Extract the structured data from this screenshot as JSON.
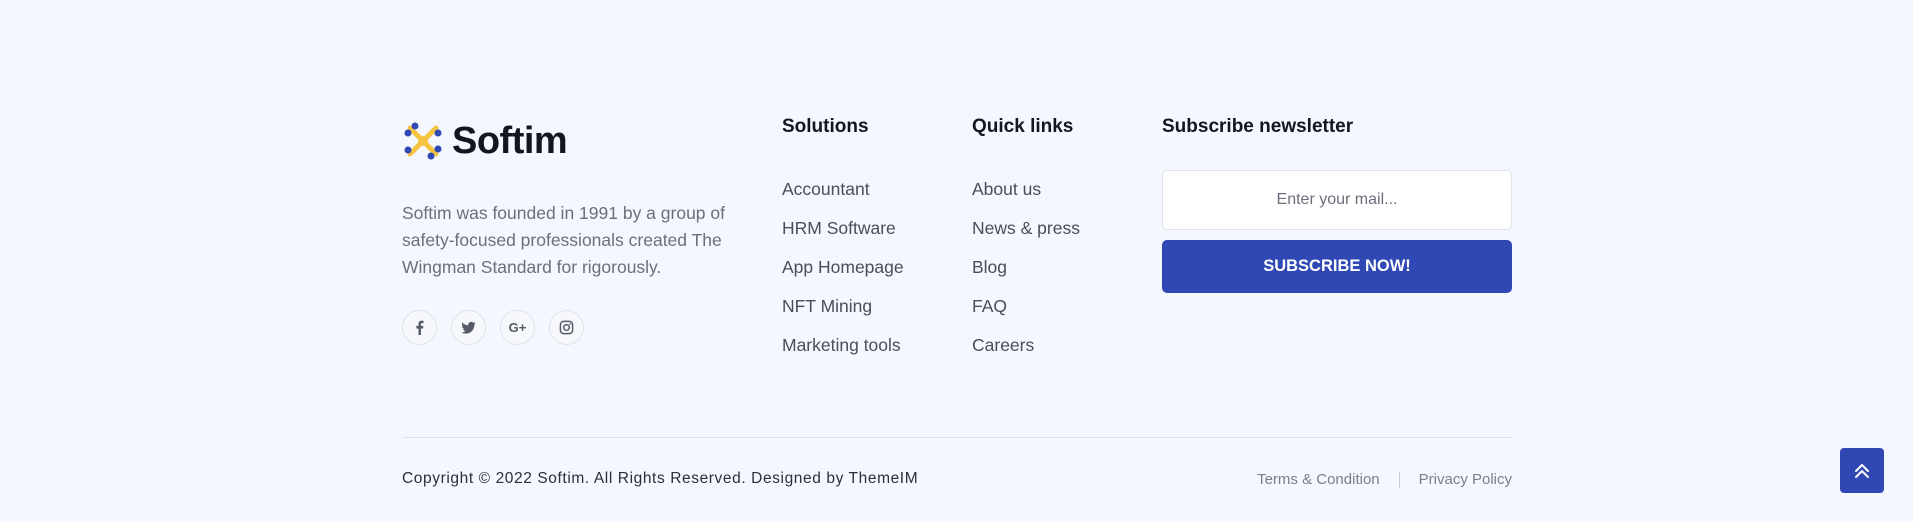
{
  "brand": {
    "name": "Softim",
    "about": "Softim was founded in 1991 by a group of safety-focused professionals created The Wingman Standard for rigorously.",
    "colors": {
      "primary": "#3048b4",
      "accent": "#f5c443"
    }
  },
  "socials": [
    {
      "icon": "facebook-icon"
    },
    {
      "icon": "twitter-icon"
    },
    {
      "icon": "google-plus-icon",
      "glyph": "G+"
    },
    {
      "icon": "instagram-icon"
    }
  ],
  "solutions": {
    "title": "Solutions",
    "items": [
      "Accountant",
      "HRM Software",
      "App Homepage",
      "NFT Mining",
      "Marketing tools"
    ]
  },
  "quick_links": {
    "title": "Quick links",
    "items": [
      "About us",
      "News & press",
      "Blog",
      "FAQ",
      "Careers"
    ]
  },
  "newsletter": {
    "title": "Subscribe newsletter",
    "placeholder": "Enter your mail...",
    "button_label": "SUBSCRIBE NOW!"
  },
  "bottom": {
    "copyright": "Copyright © 2022 Softim. All Rights Reserved. Designed by ThemeIM",
    "terms": "Terms & Condition",
    "privacy": "Privacy Policy"
  },
  "scroll_top": {
    "icon": "double-chevron-up-icon"
  }
}
